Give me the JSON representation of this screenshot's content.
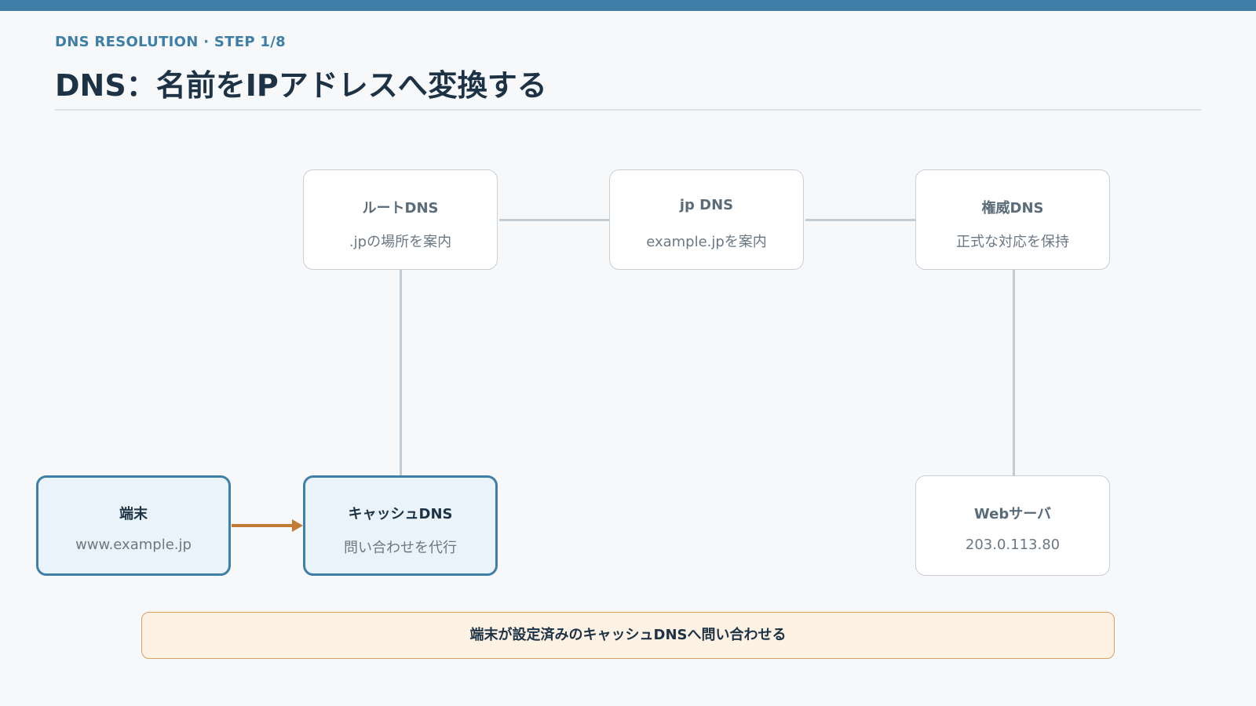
{
  "header": {
    "eyebrow": "DNS RESOLUTION · STEP 1/8",
    "title": "DNS：名前をIPアドレスへ変換する"
  },
  "nodes": {
    "root_dns": {
      "title": "ルートDNS",
      "subtitle": ".jpの場所を案内"
    },
    "jp_dns": {
      "title": "jp DNS",
      "subtitle": "example.jpを案内"
    },
    "authoritative_dns": {
      "title": "権威DNS",
      "subtitle": "正式な対応を保持"
    },
    "client": {
      "title": "端末",
      "subtitle": "www.example.jp"
    },
    "cache_dns": {
      "title": "キャッシュDNS",
      "subtitle": "問い合わせを代行"
    },
    "web_server": {
      "title": "Webサーバ",
      "subtitle": "203.0.113.80"
    }
  },
  "step_message": "端末が設定済みのキャッシュDNSへ問い合わせる",
  "colors": {
    "accent": "#3f7ea6",
    "arrow": "#c37a35",
    "message_bg": "#fdf2e4",
    "active_node_bg": "#eaf3fa"
  }
}
